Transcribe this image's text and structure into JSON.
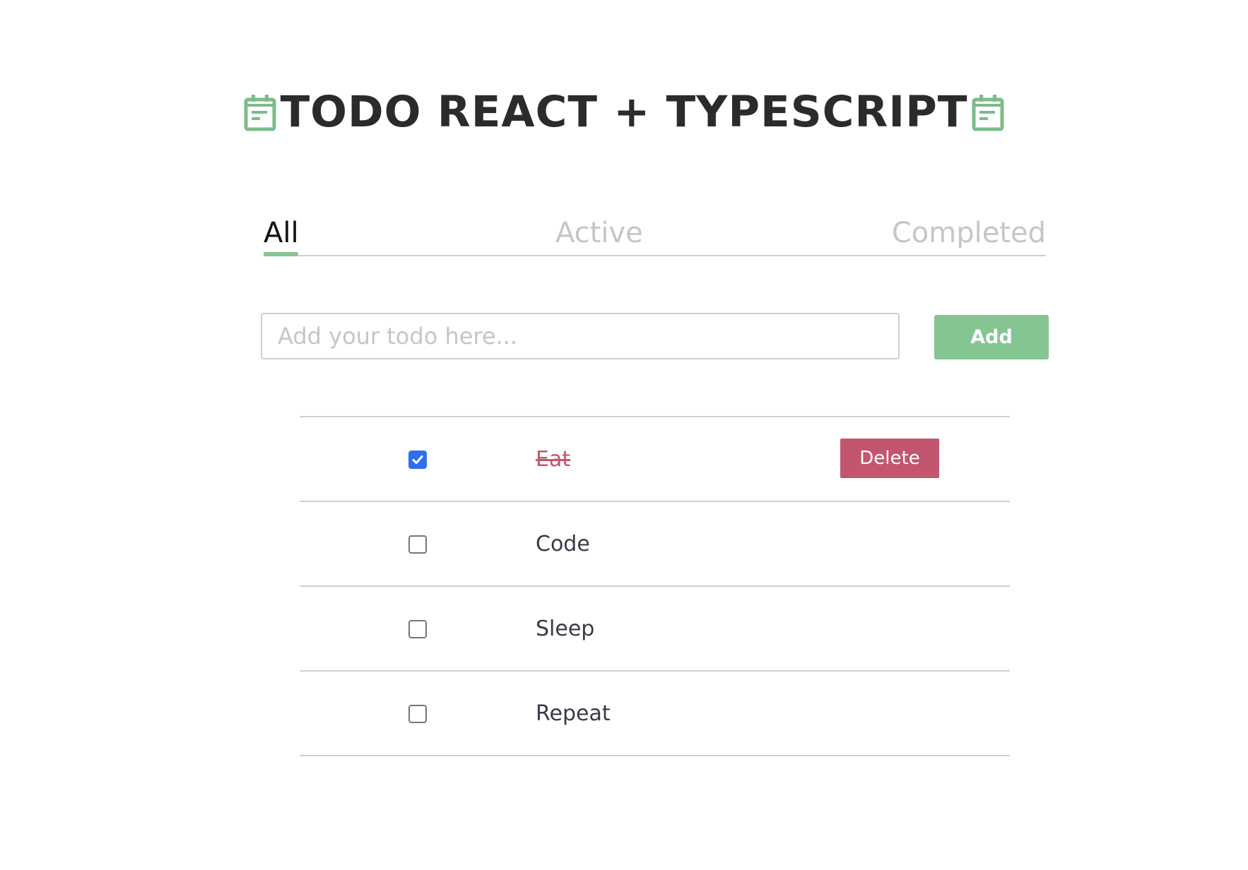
{
  "header": {
    "title": "TODO REACT + TYPESCRIPT",
    "icon_left": "calendar-icon",
    "icon_right": "calendar-icon",
    "icon_color": "#7dbb8b"
  },
  "tabs": [
    {
      "label": "All",
      "selected": true
    },
    {
      "label": "Active",
      "selected": false
    },
    {
      "label": "Completed",
      "selected": false
    }
  ],
  "input": {
    "placeholder": "Add your todo here...",
    "value": ""
  },
  "add_button": {
    "label": "Add",
    "color": "#85c592"
  },
  "todos": [
    {
      "text": "Eat",
      "completed": true,
      "delete_label": "Delete"
    },
    {
      "text": "Code",
      "completed": false
    },
    {
      "text": "Sleep",
      "completed": false
    },
    {
      "text": "Repeat",
      "completed": false
    }
  ],
  "colors": {
    "accent_green": "#85c592",
    "delete_red": "#c3566f",
    "checkbox_blue": "#2f6fef"
  }
}
